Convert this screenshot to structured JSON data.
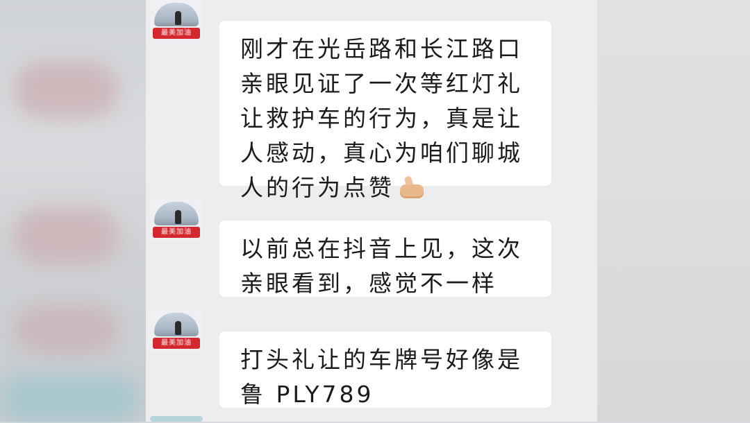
{
  "messages": [
    {
      "sender": "",
      "avatar_banner": "最美加油",
      "lines": [
        "刚才在光岳路和长江路口",
        "亲眼见证了一次等红灯礼",
        "让救护车的行为，真是让",
        "人感动，真心为咱们聊城",
        "人的行为点赞"
      ],
      "emoji": "thumbs-up"
    },
    {
      "sender": "",
      "avatar_banner": "最美加油",
      "lines": [
        "以前总在抖音上见，这次",
        "亲眼看到，感觉不一样"
      ]
    },
    {
      "sender": "",
      "avatar_banner": "最美加油",
      "lines": [
        "打头礼让的车牌号好像是",
        "鲁 PLY789"
      ]
    }
  ],
  "colors": {
    "chat_background": "#ededed",
    "bubble": "#ffffff",
    "text": "#1b1b1b",
    "avatar_banner": "#d4282e"
  }
}
